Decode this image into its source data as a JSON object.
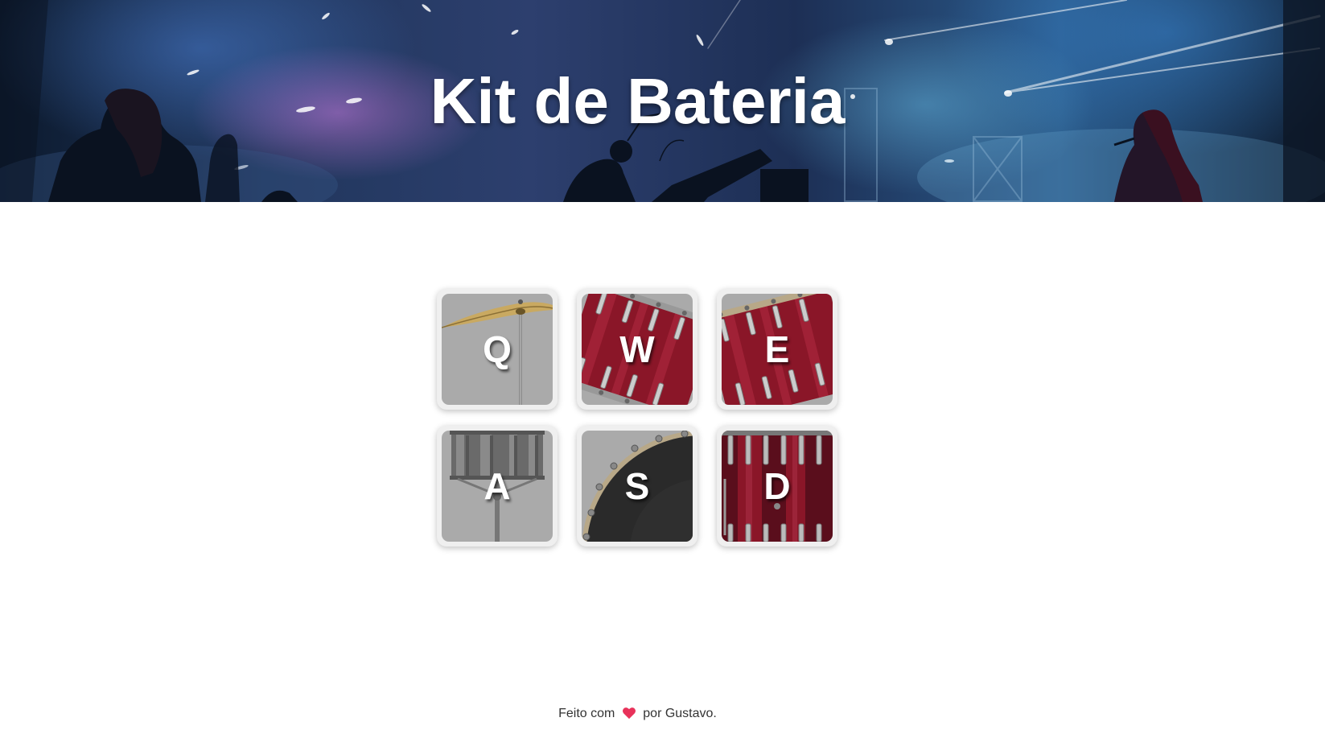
{
  "header": {
    "title": "Kit de Bateria"
  },
  "pads": [
    {
      "key": "Q",
      "instrument": "crash-cymbal"
    },
    {
      "key": "W",
      "instrument": "tom-1"
    },
    {
      "key": "E",
      "instrument": "tom-2"
    },
    {
      "key": "A",
      "instrument": "snare"
    },
    {
      "key": "S",
      "instrument": "kick-bass"
    },
    {
      "key": "D",
      "instrument": "floor-tom"
    }
  ],
  "footer": {
    "prefix": "Feito com",
    "suffix": "por Gustavo.",
    "heart_icon": "heart-icon",
    "heart_color": "#e8325a"
  },
  "colors": {
    "pad_frame": "#efefef",
    "pad_tile": "#aaaaaa",
    "drum_red": "#8a1628",
    "cymbal_gold": "#c9a961"
  }
}
